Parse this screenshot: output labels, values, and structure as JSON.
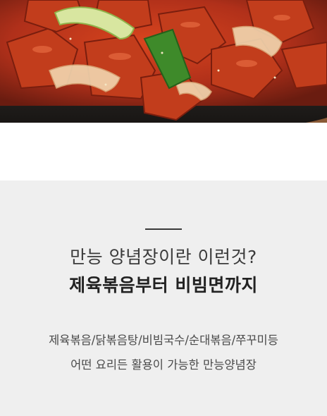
{
  "hero": {
    "image_subject": "stir-fried spicy pork with vegetables on a sizzling cast iron plate"
  },
  "intro": {
    "headline": "만능 양념장이란 이런것?",
    "subheadline": "제육볶음부터 비빔면까지",
    "description_line1": "제육볶음/닭볶음탕/비빔국수/순대볶음/쭈꾸미등",
    "description_line2": "어떤 요리든 활용이 가능한 만능양념장"
  },
  "colors": {
    "section_background": "#efefef",
    "headline_text": "#3b3b3b",
    "subheadline_text": "#222222",
    "body_text": "#4a4a4a"
  }
}
